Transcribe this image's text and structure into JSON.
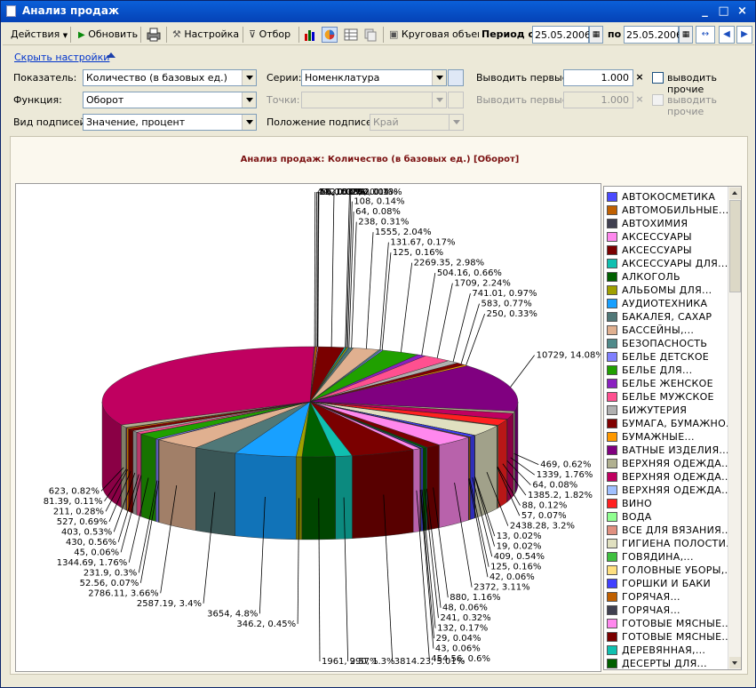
{
  "window": {
    "title": "Анализ продаж"
  },
  "toolbar": {
    "actions_label": "Действия",
    "refresh_label": "Обновить",
    "settings_label": "Настройка",
    "filter_label": "Отбор",
    "chart_type_label": "Круговая объем",
    "period_label": "Период с",
    "date_from": "25.05.2006",
    "to_label": "по",
    "date_to": "25.05.2006"
  },
  "settings": {
    "hide_link": "Скрыть настройки",
    "indicator_label": "Показатель:",
    "indicator_value": "Количество (в базовых ед.)",
    "function_label": "Функция:",
    "function_value": "Оборот",
    "label_type_label": "Вид подписей:",
    "label_type_value": "Значение, процент",
    "series_label": "Серии:",
    "series_value": "Номенклатура",
    "points_label": "Точки:",
    "points_value": "",
    "label_position_label": "Положение подписей:",
    "label_position_value": "Край",
    "first1_label": "Выводить первые",
    "first1_value": "1.000",
    "other1_label": "выводить прочие",
    "first2_label": "Выводить первые",
    "first2_value": "1.000",
    "other2_label": "выводить прочие"
  },
  "chart_data": {
    "type": "pie",
    "title": "Анализ продаж: Количество (в базовых ед.) [Оборот]",
    "slices": [
      {
        "label": "44, 0.06%",
        "value": 44
      },
      {
        "label": "132, 0.17%",
        "value": 132
      },
      {
        "label": "19, 0.02%",
        "value": 19
      },
      {
        "label": "56, 0.07%",
        "value": 56
      },
      {
        "label": "1535, 2.01%",
        "value": 1535
      },
      {
        "label": "100, 0.13%",
        "value": 100
      },
      {
        "label": "33, 0.04%",
        "value": 33
      },
      {
        "label": "108, 0.14%",
        "value": 108
      },
      {
        "label": "64, 0.08%",
        "value": 64
      },
      {
        "label": "238, 0.31%",
        "value": 238
      },
      {
        "label": "1555, 2.04%",
        "value": 1555
      },
      {
        "label": "131.67, 0.17%",
        "value": 131.67
      },
      {
        "label": "125, 0.16%",
        "value": 125
      },
      {
        "label": "2269.35, 2.98%",
        "value": 2269.35
      },
      {
        "label": "504.16, 0.66%",
        "value": 504.16
      },
      {
        "label": "1709, 2.24%",
        "value": 1709
      },
      {
        "label": "741.01, 0.97%",
        "value": 741.01
      },
      {
        "label": "583, 0.77%",
        "value": 583
      },
      {
        "label": "250, 0.33%",
        "value": 250
      },
      {
        "label": "10729, 14.08%",
        "value": 10729
      },
      {
        "label": "469, 0.62%",
        "value": 469
      },
      {
        "label": "1339, 1.76%",
        "value": 1339
      },
      {
        "label": "64, 0.08%",
        "value": 64
      },
      {
        "label": "1385.2, 1.82%",
        "value": 1385.2
      },
      {
        "label": "88, 0.12%",
        "value": 88
      },
      {
        "label": "57, 0.07%",
        "value": 57
      },
      {
        "label": "2438.28, 3.2%",
        "value": 2438.28
      },
      {
        "label": "13, 0.02%",
        "value": 13
      },
      {
        "label": "19, 0.02%",
        "value": 19
      },
      {
        "label": "409, 0.54%",
        "value": 409
      },
      {
        "label": "125, 0.16%",
        "value": 125
      },
      {
        "label": "42, 0.06%",
        "value": 42
      },
      {
        "label": "2372, 3.11%",
        "value": 2372
      },
      {
        "label": "880, 1.16%",
        "value": 880
      },
      {
        "label": "48, 0.06%",
        "value": 48
      },
      {
        "label": "241, 0.32%",
        "value": 241
      },
      {
        "label": "132, 0.17%",
        "value": 132
      },
      {
        "label": "29, 0.04%",
        "value": 29
      },
      {
        "label": "43, 0.06%",
        "value": 43
      },
      {
        "label": "454.56, 0.6%",
        "value": 454.56
      },
      {
        "label": "3814.23, 5.01%",
        "value": 3814.23
      },
      {
        "label": "990, 1.3%",
        "value": 990
      },
      {
        "label": "1961, 2.57%",
        "value": 1961
      },
      {
        "label": "346.2, 0.45%",
        "value": 346.2
      },
      {
        "label": "3654, 4.8%",
        "value": 3654
      },
      {
        "label": "2587.19, 3.4%",
        "value": 2587.19
      },
      {
        "label": "2786.11, 3.66%",
        "value": 2786.11
      },
      {
        "label": "52.56, 0.07%",
        "value": 52.56
      },
      {
        "label": "231.9, 0.3%",
        "value": 231.9
      },
      {
        "label": "1344.69, 1.76%",
        "value": 1344.69
      },
      {
        "label": "45, 0.06%",
        "value": 45
      },
      {
        "label": "430, 0.56%",
        "value": 430
      },
      {
        "label": "403, 0.53%",
        "value": 403
      },
      {
        "label": "527, 0.69%",
        "value": 527
      },
      {
        "label": "211, 0.28%",
        "value": 211
      },
      {
        "label": "81.39, 0.11%",
        "value": 81.39
      },
      {
        "label": "623, 0.82%",
        "value": 623
      }
    ],
    "legend": [
      {
        "name": "АВТОКОСМЕТИКА",
        "color": "#4a4aff"
      },
      {
        "name": "АВТОМОБИЛЬНЫЕ...",
        "color": "#c06000"
      },
      {
        "name": "АВТОХИМИЯ",
        "color": "#404050"
      },
      {
        "name": "АКСЕССУАРЫ",
        "color": "#ff88ee"
      },
      {
        "name": "АКСЕССУАРЫ",
        "color": "#7a0000"
      },
      {
        "name": "АКСЕССУАРЫ ДЛЯ...",
        "color": "#10c0b0"
      },
      {
        "name": "АЛКОГОЛЬ",
        "color": "#006000"
      },
      {
        "name": "АЛЬБОМЫ ДЛЯ...",
        "color": "#a0a000"
      },
      {
        "name": "АУДИОТЕХНИКА",
        "color": "#18a0ff"
      },
      {
        "name": "БАКАЛЕЯ, САХАР",
        "color": "#507878"
      },
      {
        "name": "БАССЕЙНЫ,...",
        "color": "#e0b090"
      },
      {
        "name": "БЕЗОПАСНОСТЬ",
        "color": "#508a8a"
      },
      {
        "name": "БЕЛЬЕ ДЕТСКОЕ",
        "color": "#8080ff"
      },
      {
        "name": "БЕЛЬЕ ДЛЯ...",
        "color": "#20a000"
      },
      {
        "name": "БЕЛЬЕ ЖЕНСКОЕ",
        "color": "#8a20c0"
      },
      {
        "name": "БЕЛЬЕ МУЖСКОЕ",
        "color": "#ff5090"
      },
      {
        "name": "БИЖУТЕРИЯ",
        "color": "#b0b0b0"
      },
      {
        "name": "БУМАГА, БУМАЖНО...",
        "color": "#800000"
      },
      {
        "name": "БУМАЖНЫЕ...",
        "color": "#ff9900"
      },
      {
        "name": "ВАТНЫЕ ИЗДЕЛИЯ...",
        "color": "#800080"
      },
      {
        "name": "ВЕРХНЯЯ ОДЕЖДА...",
        "color": "#b0b090"
      },
      {
        "name": "ВЕРХНЯЯ ОДЕЖДА...",
        "color": "#c00060"
      },
      {
        "name": "ВЕРХНЯЯ ОДЕЖДА...",
        "color": "#a0c0ff"
      },
      {
        "name": "ВИНО",
        "color": "#ff2020"
      },
      {
        "name": "ВОДА",
        "color": "#90ff90"
      },
      {
        "name": "ВСЕ ДЛЯ ВЯЗАНИЯ...",
        "color": "#e09080"
      },
      {
        "name": "ГИГИЕНА ПОЛОСТИ...",
        "color": "#e0e0c0"
      },
      {
        "name": "ГОВЯДИНА,...",
        "color": "#40c040"
      },
      {
        "name": "ГОЛОВНЫЕ УБОРЫ,...",
        "color": "#ffe080"
      },
      {
        "name": "ГОРШКИ И БАКИ",
        "color": "#4040ff"
      },
      {
        "name": "ГОРЯЧАЯ...",
        "color": "#c06000"
      },
      {
        "name": "ГОРЯЧАЯ...",
        "color": "#404050"
      },
      {
        "name": "ГОТОВЫЕ МЯСНЫЕ...",
        "color": "#ff88ee"
      },
      {
        "name": "ГОТОВЫЕ МЯСНЫЕ...",
        "color": "#7a0000"
      },
      {
        "name": "ДЕРЕВЯННАЯ,...",
        "color": "#10c0b0"
      },
      {
        "name": "ДЕСЕРТЫ ДЛЯ...",
        "color": "#006000"
      }
    ]
  }
}
